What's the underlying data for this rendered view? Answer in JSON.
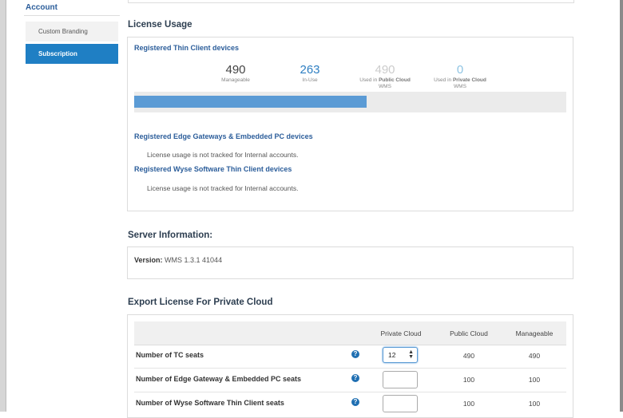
{
  "sidebar": {
    "heading": "Account",
    "items": [
      {
        "label": "Custom Branding"
      },
      {
        "label": "Subscription"
      }
    ]
  },
  "license_usage": {
    "title": "License Usage",
    "thin_client": {
      "title": "Registered Thin Client devices",
      "stats": [
        {
          "value": "490",
          "label": "Manageable",
          "color": "#444444"
        },
        {
          "value": "263",
          "label": "In-Use",
          "color": "#2e7fc2"
        },
        {
          "value": "490",
          "label_pre": "Used in ",
          "label_bold": "Public Cloud",
          "label_post": " WMS",
          "color": "#cccccc"
        },
        {
          "value": "0",
          "label_pre": "Used in ",
          "label_bold": "Private Cloud",
          "label_post": " WMS",
          "color": "#8fc4e3"
        }
      ],
      "usage_fraction": 0.537
    },
    "edge": {
      "title": "Registered Edge Gateways & Embedded PC devices",
      "note": "License usage is not tracked for Internal accounts."
    },
    "wyse": {
      "title": "Registered Wyse Software Thin Client devices",
      "note": "License usage is not tracked for Internal accounts."
    }
  },
  "server": {
    "title": "Server Information:",
    "version_label": "Version:",
    "version_value": "WMS 1.3.1 41044"
  },
  "export": {
    "title": "Export License For Private Cloud",
    "columns": [
      "Private Cloud",
      "Public Cloud",
      "Manageable"
    ],
    "rows": [
      {
        "label": "Number of TC seats",
        "private_value": "12",
        "public": "490",
        "manageable": "490"
      },
      {
        "label": "Number of Edge Gateway & Embedded PC seats",
        "private_value": "",
        "public": "100",
        "manageable": "100"
      },
      {
        "label": "Number of Wyse Software Thin Client seats",
        "private_value": "",
        "public": "100",
        "manageable": "100"
      }
    ],
    "help_icon": "question-circle-icon",
    "accent": "#1f6fb2"
  }
}
